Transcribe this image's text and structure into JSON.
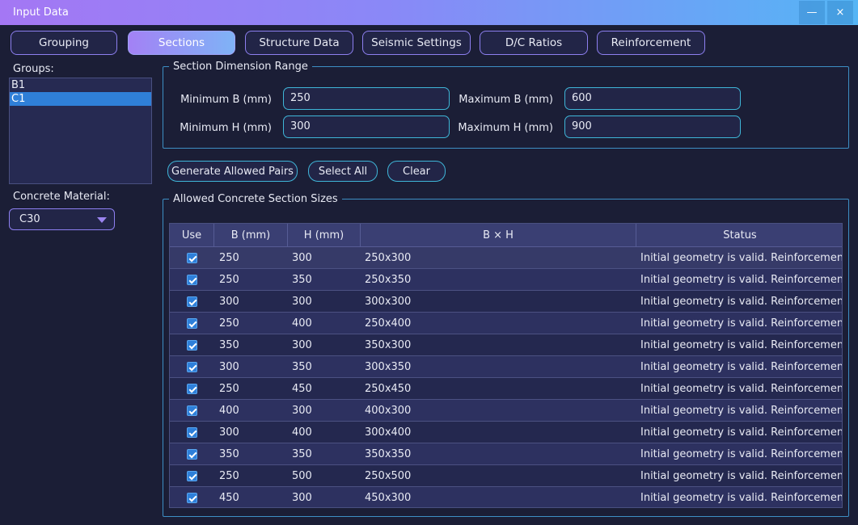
{
  "window": {
    "title": "Input Data",
    "minimize_label": "—",
    "close_label": "×"
  },
  "tabs": [
    {
      "label": "Grouping",
      "active": false
    },
    {
      "label": "Sections",
      "active": true
    },
    {
      "label": "Structure Data",
      "active": false
    },
    {
      "label": "Seismic Settings",
      "active": false
    },
    {
      "label": "D/C Ratios",
      "active": false
    },
    {
      "label": "Reinforcement",
      "active": false
    }
  ],
  "sidebar": {
    "groups_label": "Groups:",
    "groups": [
      "B1",
      "C1"
    ],
    "selected_group": "C1",
    "concrete_label": "Concrete Material:",
    "concrete_value": "C30"
  },
  "dimension_range": {
    "title": "Section Dimension Range",
    "min_b_label": "Minimum B (mm)",
    "min_b_value": "250",
    "max_b_label": "Maximum B (mm)",
    "max_b_value": "600",
    "min_h_label": "Minimum H (mm)",
    "min_h_value": "300",
    "max_h_label": "Maximum H (mm)",
    "max_h_value": "900"
  },
  "actions": {
    "generate_label": "Generate Allowed Pairs",
    "select_all_label": "Select All",
    "clear_label": "Clear"
  },
  "table": {
    "title": "Allowed Concrete Section Sizes",
    "headers": [
      "Use",
      "B (mm)",
      "H (mm)",
      "B × H",
      "Status"
    ],
    "rows": [
      {
        "use": true,
        "b": "250",
        "h": "300",
        "bxh": "250x300",
        "status": "Initial geometry is valid. Reinforcement ..."
      },
      {
        "use": true,
        "b": "250",
        "h": "350",
        "bxh": "250x350",
        "status": "Initial geometry is valid. Reinforcement ..."
      },
      {
        "use": true,
        "b": "300",
        "h": "300",
        "bxh": "300x300",
        "status": "Initial geometry is valid. Reinforcement ..."
      },
      {
        "use": true,
        "b": "250",
        "h": "400",
        "bxh": "250x400",
        "status": "Initial geometry is valid. Reinforcement ..."
      },
      {
        "use": true,
        "b": "350",
        "h": "300",
        "bxh": "350x300",
        "status": "Initial geometry is valid. Reinforcement ..."
      },
      {
        "use": true,
        "b": "300",
        "h": "350",
        "bxh": "300x350",
        "status": "Initial geometry is valid. Reinforcement ..."
      },
      {
        "use": true,
        "b": "250",
        "h": "450",
        "bxh": "250x450",
        "status": "Initial geometry is valid. Reinforcement ..."
      },
      {
        "use": true,
        "b": "400",
        "h": "300",
        "bxh": "400x300",
        "status": "Initial geometry is valid. Reinforcement ..."
      },
      {
        "use": true,
        "b": "300",
        "h": "400",
        "bxh": "300x400",
        "status": "Initial geometry is valid. Reinforcement ..."
      },
      {
        "use": true,
        "b": "350",
        "h": "350",
        "bxh": "350x350",
        "status": "Initial geometry is valid. Reinforcement ..."
      },
      {
        "use": true,
        "b": "250",
        "h": "500",
        "bxh": "250x500",
        "status": "Initial geometry is valid. Reinforcement ..."
      },
      {
        "use": true,
        "b": "450",
        "h": "300",
        "bxh": "450x300",
        "status": "Initial geometry is valid. Reinforcement ..."
      }
    ]
  },
  "colors": {
    "background": "#1b1e36",
    "accent_purple": "#8d7ff0",
    "accent_cyan": "#3fb6d8",
    "selection_blue": "#2f7fd8"
  }
}
